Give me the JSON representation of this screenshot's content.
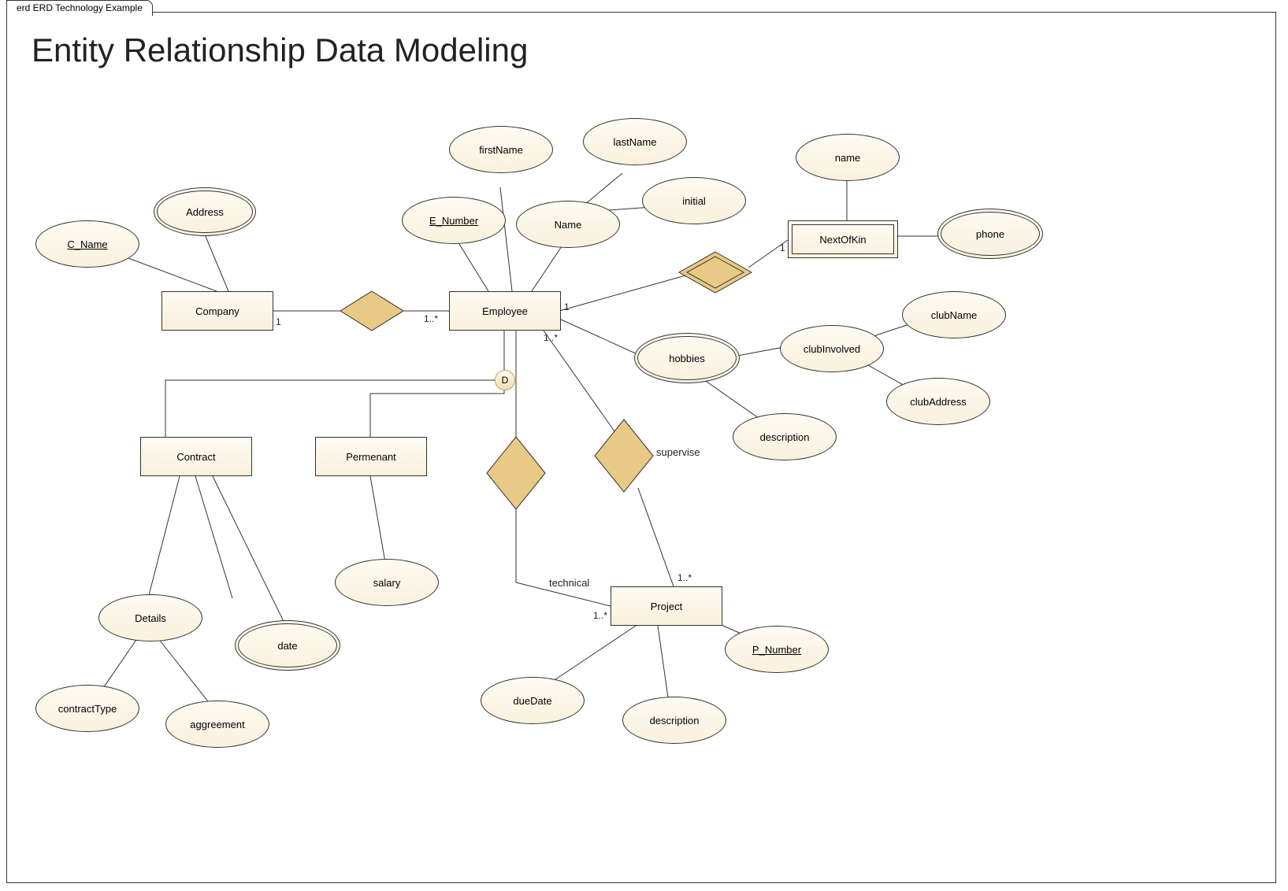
{
  "tab_title": "erd ERD Technology Example",
  "title": "Entity Relationship Data Modeling",
  "entities": {
    "company": "Company",
    "employee": "Employee",
    "nextofkin": "NextOfKin",
    "contract": "Contract",
    "permenant": "Permenant",
    "project": "Project"
  },
  "attributes": {
    "c_name": "C_Name",
    "address": "Address",
    "e_number": "E_Number",
    "name": "Name",
    "firstName": "firstName",
    "lastName": "lastName",
    "initial": "initial",
    "nok_name": "name",
    "phone": "phone",
    "hobbies": "hobbies",
    "clubInvolved": "clubInvolved",
    "clubName": "clubName",
    "clubAddress": "clubAddress",
    "nok_description": "description",
    "details": "Details",
    "date": "date",
    "contractType": "contractType",
    "aggreement": "aggreement",
    "salary": "salary",
    "p_number": "P_Number",
    "dueDate": "dueDate",
    "p_description": "description"
  },
  "relationships": {
    "supervise": "supervise",
    "technical": "technical"
  },
  "disjoint": "D",
  "cardinalities": {
    "company_side": "1",
    "employee_from_company": "1..*",
    "employee_to_nok": "1",
    "nok_side": "1",
    "employee_to_project": "1..*",
    "project_from_supervise": "1..*",
    "project_from_technical": "1..*"
  }
}
